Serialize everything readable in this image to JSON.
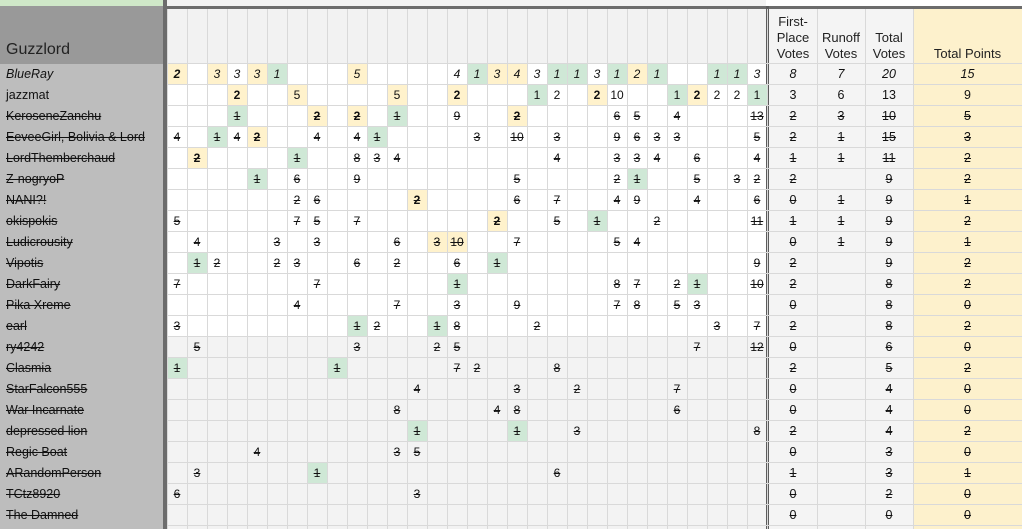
{
  "sheet_title": "Guzzlord",
  "headers": {
    "first_place": "First-\nPlace\nVotes",
    "runoff": "Runoff\nVotes",
    "total": "Total\nVotes",
    "points": "Total Points"
  },
  "rows": [
    {
      "name": "BlueRay",
      "style": "italic",
      "first": "8",
      "runoff": "7",
      "total": "20",
      "points": "15",
      "cells": [
        [
          0,
          "2",
          "y",
          true
        ],
        [
          2,
          "3",
          "y",
          false
        ],
        [
          3,
          "3",
          "",
          false
        ],
        [
          4,
          "3",
          "y",
          false
        ],
        [
          5,
          "1",
          "g",
          false
        ],
        [
          9,
          "5",
          "y",
          false
        ],
        [
          14,
          "4",
          "",
          false
        ],
        [
          15,
          "1",
          "g",
          false
        ],
        [
          16,
          "3",
          "y",
          false
        ],
        [
          17,
          "4",
          "y",
          false
        ],
        [
          18,
          "3",
          "",
          false
        ],
        [
          19,
          "1",
          "g",
          false
        ],
        [
          20,
          "1",
          "g",
          false
        ],
        [
          21,
          "3",
          "",
          false
        ],
        [
          22,
          "1",
          "g",
          false
        ],
        [
          23,
          "2",
          "y",
          false
        ],
        [
          24,
          "1",
          "g",
          false
        ],
        [
          27,
          "1",
          "g",
          false
        ],
        [
          28,
          "1",
          "g",
          false
        ],
        [
          29,
          "3",
          "",
          false
        ]
      ]
    },
    {
      "name": "jazzmat",
      "style": "",
      "first": "3",
      "runoff": "6",
      "total": "13",
      "points": "9",
      "cells": [
        [
          3,
          "2",
          "y",
          true
        ],
        [
          6,
          "5",
          "y",
          false
        ],
        [
          11,
          "5",
          "y",
          false
        ],
        [
          14,
          "2",
          "y",
          true
        ],
        [
          18,
          "1",
          "g",
          false
        ],
        [
          19,
          "2",
          "",
          false
        ],
        [
          21,
          "2",
          "y",
          true
        ],
        [
          22,
          "10",
          "",
          false
        ],
        [
          25,
          "1",
          "g",
          false
        ],
        [
          26,
          "2",
          "y",
          true
        ],
        [
          27,
          "2",
          "",
          false
        ],
        [
          28,
          "2",
          "",
          false
        ],
        [
          29,
          "1",
          "g",
          false
        ]
      ]
    },
    {
      "name": "KeroseneZanchu",
      "style": "strike",
      "first": "2",
      "runoff": "3",
      "total": "10",
      "points": "5",
      "cells": [
        [
          3,
          "1",
          "g",
          false
        ],
        [
          7,
          "2",
          "y",
          true
        ],
        [
          9,
          "2",
          "y",
          true
        ],
        [
          11,
          "1",
          "g",
          false
        ],
        [
          14,
          "9",
          "",
          false
        ],
        [
          17,
          "2",
          "y",
          true
        ],
        [
          22,
          "6",
          "",
          false
        ],
        [
          23,
          "5",
          "",
          false
        ],
        [
          25,
          "4",
          "",
          false
        ],
        [
          29,
          "13",
          "",
          false
        ]
      ]
    },
    {
      "name": "EeveeGirl, Bolivia & Lord",
      "style": "strike",
      "first": "2",
      "runoff": "1",
      "total": "15",
      "points": "3",
      "cells": [
        [
          0,
          "4",
          "",
          false
        ],
        [
          2,
          "1",
          "g",
          false
        ],
        [
          3,
          "4",
          "",
          false
        ],
        [
          4,
          "2",
          "y",
          true
        ],
        [
          7,
          "4",
          "",
          false
        ],
        [
          9,
          "4",
          "",
          false
        ],
        [
          10,
          "1",
          "g",
          false
        ],
        [
          15,
          "3",
          "",
          false
        ],
        [
          17,
          "10",
          "",
          false
        ],
        [
          19,
          "3",
          "",
          false
        ],
        [
          22,
          "9",
          "",
          false
        ],
        [
          23,
          "6",
          "",
          false
        ],
        [
          24,
          "3",
          "",
          false
        ],
        [
          25,
          "3",
          "",
          false
        ],
        [
          29,
          "5",
          "",
          false
        ]
      ]
    },
    {
      "name": "LordThemberchaud",
      "style": "strike",
      "first": "1",
      "runoff": "1",
      "total": "11",
      "points": "2",
      "cells": [
        [
          1,
          "2",
          "y",
          true
        ],
        [
          6,
          "1",
          "g",
          false
        ],
        [
          9,
          "8",
          "",
          false
        ],
        [
          10,
          "3",
          "",
          false
        ],
        [
          11,
          "4",
          "",
          false
        ],
        [
          19,
          "4",
          "",
          false
        ],
        [
          22,
          "3",
          "",
          false
        ],
        [
          23,
          "3",
          "",
          false
        ],
        [
          24,
          "4",
          "",
          false
        ],
        [
          26,
          "6",
          "",
          false
        ],
        [
          29,
          "4",
          "",
          false
        ]
      ]
    },
    {
      "name": "Z-nogryoP",
      "style": "strike",
      "first": "2",
      "runoff": "",
      "total": "9",
      "points": "2",
      "cells": [
        [
          4,
          "1",
          "g",
          false
        ],
        [
          6,
          "6",
          "",
          false
        ],
        [
          9,
          "9",
          "",
          false
        ],
        [
          17,
          "5",
          "",
          false
        ],
        [
          22,
          "2",
          "",
          false
        ],
        [
          23,
          "1",
          "g",
          false
        ],
        [
          26,
          "5",
          "",
          false
        ],
        [
          28,
          "3",
          "",
          false
        ],
        [
          29,
          "2",
          "",
          false
        ]
      ]
    },
    {
      "name": "NANI?!",
      "style": "strike",
      "first": "0",
      "runoff": "1",
      "total": "9",
      "points": "1",
      "cells": [
        [
          6,
          "2",
          "",
          false
        ],
        [
          7,
          "6",
          "",
          false
        ],
        [
          12,
          "2",
          "y",
          true
        ],
        [
          17,
          "6",
          "",
          false
        ],
        [
          19,
          "7",
          "",
          false
        ],
        [
          22,
          "4",
          "",
          false
        ],
        [
          23,
          "9",
          "",
          false
        ],
        [
          26,
          "4",
          "",
          false
        ],
        [
          29,
          "6",
          "",
          false
        ]
      ]
    },
    {
      "name": "okispokis",
      "style": "strike",
      "first": "1",
      "runoff": "1",
      "total": "9",
      "points": "2",
      "cells": [
        [
          0,
          "5",
          "",
          false
        ],
        [
          6,
          "7",
          "",
          false
        ],
        [
          7,
          "5",
          "",
          false
        ],
        [
          9,
          "7",
          "",
          false
        ],
        [
          16,
          "2",
          "y",
          true
        ],
        [
          19,
          "5",
          "",
          false
        ],
        [
          21,
          "1",
          "g",
          false
        ],
        [
          24,
          "2",
          "",
          false
        ],
        [
          29,
          "11",
          "",
          false
        ]
      ]
    },
    {
      "name": "Ludicrousity",
      "style": "strike",
      "first": "0",
      "runoff": "1",
      "total": "9",
      "points": "1",
      "cells": [
        [
          1,
          "4",
          "",
          false
        ],
        [
          5,
          "3",
          "",
          false
        ],
        [
          7,
          "3",
          "",
          false
        ],
        [
          11,
          "6",
          "",
          false
        ],
        [
          13,
          "3",
          "y",
          false
        ],
        [
          14,
          "10",
          "y",
          false
        ],
        [
          17,
          "7",
          "",
          false
        ],
        [
          22,
          "5",
          "",
          false
        ],
        [
          23,
          "4",
          "",
          false
        ]
      ]
    },
    {
      "name": "Vipotis",
      "style": "strike",
      "first": "2",
      "runoff": "",
      "total": "9",
      "points": "2",
      "cells": [
        [
          1,
          "1",
          "g",
          false
        ],
        [
          2,
          "2",
          "",
          false
        ],
        [
          5,
          "2",
          "",
          false
        ],
        [
          6,
          "3",
          "",
          false
        ],
        [
          9,
          "6",
          "",
          false
        ],
        [
          11,
          "2",
          "",
          false
        ],
        [
          14,
          "6",
          "",
          false
        ],
        [
          16,
          "1",
          "g",
          false
        ],
        [
          29,
          "9",
          "",
          false
        ]
      ]
    },
    {
      "name": "DarkFairy",
      "style": "strike",
      "first": "2",
      "runoff": "",
      "total": "8",
      "points": "2",
      "cells": [
        [
          0,
          "7",
          "",
          false
        ],
        [
          7,
          "7",
          "",
          false
        ],
        [
          14,
          "1",
          "g",
          false
        ],
        [
          22,
          "8",
          "",
          false
        ],
        [
          23,
          "7",
          "",
          false
        ],
        [
          25,
          "2",
          "",
          false
        ],
        [
          26,
          "1",
          "g",
          false
        ],
        [
          29,
          "10",
          "",
          false
        ]
      ]
    },
    {
      "name": "Pika Xreme",
      "style": "strike",
      "first": "0",
      "runoff": "",
      "total": "8",
      "points": "0",
      "cells": [
        [
          6,
          "4",
          "",
          false
        ],
        [
          11,
          "7",
          "",
          false
        ],
        [
          14,
          "3",
          "",
          false
        ],
        [
          17,
          "9",
          "",
          false
        ],
        [
          22,
          "7",
          "",
          false
        ],
        [
          23,
          "8",
          "",
          false
        ],
        [
          25,
          "5",
          "",
          false
        ],
        [
          26,
          "3",
          "",
          false
        ]
      ]
    },
    {
      "name": "earl",
      "style": "strike",
      "first": "2",
      "runoff": "",
      "total": "8",
      "points": "2",
      "cells": [
        [
          0,
          "3",
          "",
          false
        ],
        [
          9,
          "1",
          "g",
          false
        ],
        [
          10,
          "2",
          "",
          false
        ],
        [
          13,
          "1",
          "g",
          false
        ],
        [
          14,
          "8",
          "",
          false
        ],
        [
          18,
          "2",
          "",
          false
        ],
        [
          27,
          "3",
          "",
          false
        ],
        [
          29,
          "7",
          "",
          false
        ]
      ]
    },
    {
      "name": "ry4242",
      "style": "strike",
      "first": "0",
      "runoff": "",
      "total": "6",
      "points": "0",
      "cells": [
        [
          1,
          "5",
          "",
          false
        ],
        [
          9,
          "3",
          "",
          false
        ],
        [
          13,
          "2",
          "",
          false
        ],
        [
          14,
          "5",
          "",
          false
        ],
        [
          26,
          "7",
          "",
          false
        ],
        [
          29,
          "12",
          "",
          false
        ]
      ]
    },
    {
      "name": "Clasmia",
      "style": "strike",
      "first": "2",
      "runoff": "",
      "total": "5",
      "points": "2",
      "cells": [
        [
          0,
          "1",
          "g",
          false
        ],
        [
          8,
          "1",
          "g",
          false
        ],
        [
          14,
          "7",
          "",
          false
        ],
        [
          15,
          "2",
          "",
          false
        ],
        [
          19,
          "8",
          "",
          false
        ]
      ]
    },
    {
      "name": "StarFalcon555",
      "style": "strike",
      "first": "0",
      "runoff": "",
      "total": "4",
      "points": "0",
      "cells": [
        [
          12,
          "4",
          "",
          false
        ],
        [
          17,
          "3",
          "",
          false
        ],
        [
          20,
          "2",
          "",
          false
        ],
        [
          25,
          "7",
          "",
          false
        ]
      ]
    },
    {
      "name": "War Incarnate",
      "style": "strike",
      "first": "0",
      "runoff": "",
      "total": "4",
      "points": "0",
      "cells": [
        [
          11,
          "8",
          "",
          false
        ],
        [
          16,
          "4",
          "",
          false
        ],
        [
          17,
          "8",
          "",
          false
        ],
        [
          25,
          "6",
          "",
          false
        ]
      ]
    },
    {
      "name": "depressed lion",
      "style": "strike",
      "first": "2",
      "runoff": "",
      "total": "4",
      "points": "2",
      "cells": [
        [
          12,
          "1",
          "g",
          false
        ],
        [
          17,
          "1",
          "g",
          false
        ],
        [
          20,
          "3",
          "",
          false
        ],
        [
          29,
          "8",
          "",
          false
        ]
      ]
    },
    {
      "name": "Regic Boat",
      "style": "strike",
      "first": "0",
      "runoff": "",
      "total": "3",
      "points": "0",
      "cells": [
        [
          4,
          "4",
          "",
          false
        ],
        [
          11,
          "3",
          "",
          false
        ],
        [
          12,
          "5",
          "",
          false
        ]
      ]
    },
    {
      "name": "ARandomPerson",
      "style": "strike",
      "first": "1",
      "runoff": "",
      "total": "3",
      "points": "1",
      "cells": [
        [
          1,
          "3",
          "",
          false
        ],
        [
          7,
          "1",
          "g",
          false
        ],
        [
          19,
          "6",
          "",
          false
        ]
      ]
    },
    {
      "name": "TCtz8920",
      "style": "strike",
      "first": "0",
      "runoff": "",
      "total": "2",
      "points": "0",
      "cells": [
        [
          0,
          "6",
          "",
          false
        ],
        [
          12,
          "3",
          "",
          false
        ]
      ]
    },
    {
      "name": "The Damned",
      "style": "strike",
      "first": "0",
      "runoff": "",
      "total": "0",
      "points": "0",
      "cells": []
    }
  ]
}
